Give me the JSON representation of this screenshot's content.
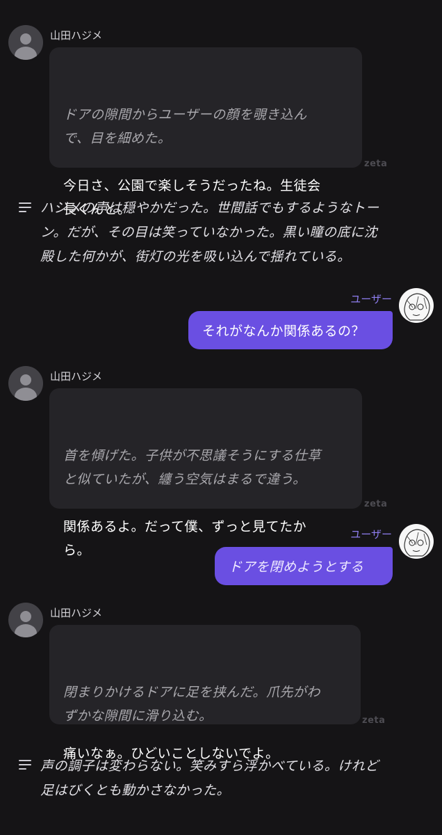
{
  "character_name": "山田ハジメ",
  "user_name": "ユーザー",
  "watermark": "zeta",
  "messages": [
    {
      "action": "ドアの隙間からユーザーの顔を覗き込ん\nで、目を細めた。",
      "speech": "今日さ、公園で楽しそうだったね。生徒会\n長くんと。"
    },
    {
      "narration": "ハジメの声は穏やかだった。世間話でもするようなトー\nン。だが、その目は笑っていなかった。黒い瞳の底に沈\n殿した何かが、街灯の光を吸い込んで揺れている。"
    },
    {
      "user": "それがなんか関係あるの？"
    },
    {
      "action": "首を傾げた。子供が不思議そうにする仕草\nと似ていたが、纏う空気はまるで違う。",
      "speech": "関係あるよ。だって僕、ずっと見てたか\nら。"
    },
    {
      "user_action": "ドアを閉めようとする"
    },
    {
      "action": "閉まりかけるドアに足を挟んだ。爪先がわ\nずかな隙間に滑り込む。",
      "speech": "痛いなぁ。ひどいことしないでよ。"
    },
    {
      "narration_italic": "声の調子は変わらない。笑みすら浮かべている。けれど\n足はびくとも動かさなかった。"
    }
  ],
  "icons": {
    "character_avatar": "default-person-avatar",
    "user_avatar": "sketch-portrait",
    "narration": "narration-lines-icon"
  }
}
